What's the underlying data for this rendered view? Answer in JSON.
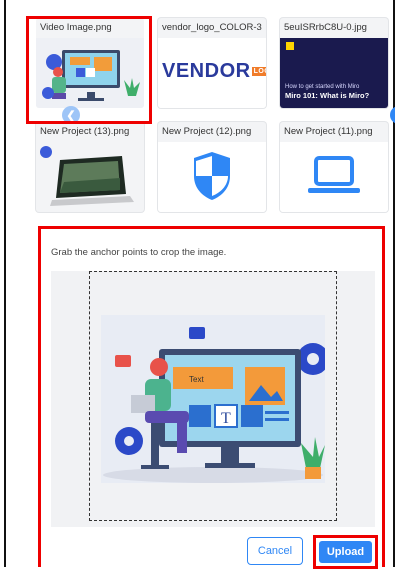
{
  "gallery": {
    "thumbnails": [
      {
        "name": "Video Image.png",
        "selected": true
      },
      {
        "name": "vendor_logo_COLOR-3...",
        "logo_text": "VENDOR",
        "logo_small": "LOGO"
      },
      {
        "name": "5euISRrbC8U-0.jpg",
        "caption_line1": "How to get started with Miro",
        "caption_line2": "Miro 101: What is Miro?"
      },
      {
        "name": "New Project (13).png"
      },
      {
        "name": "New Project (12).png"
      },
      {
        "name": "New Project (11).png"
      }
    ],
    "prev_icon": "chevron-left-icon",
    "next_icon": "chevron-right-icon"
  },
  "crop": {
    "instruction": "Grab the anchor points to crop the image.",
    "illustration_label": "Text",
    "illustration_letter": "T"
  },
  "actions": {
    "cancel_label": "Cancel",
    "upload_label": "Upload"
  },
  "colors": {
    "accent": "#2f87f5",
    "highlight": "#e00000"
  }
}
